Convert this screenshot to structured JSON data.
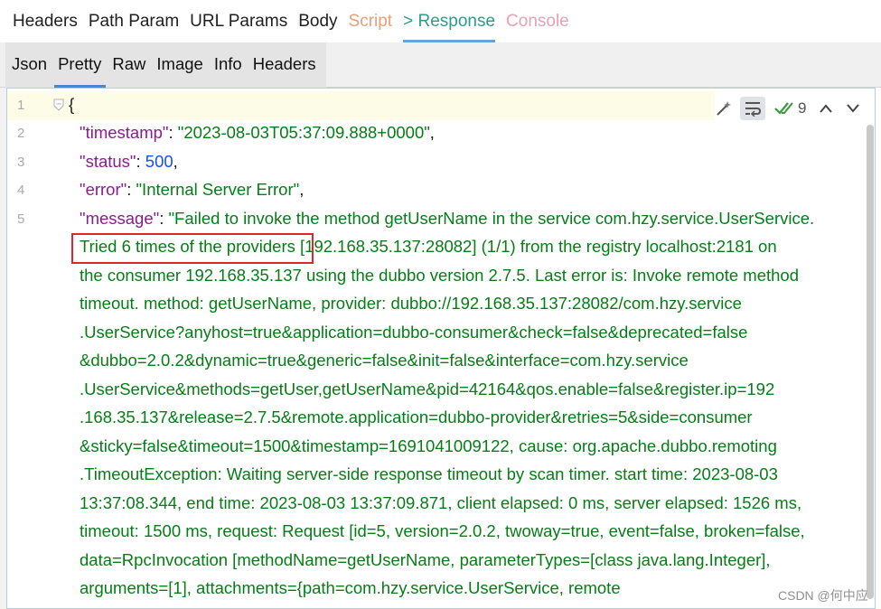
{
  "top_tabs": [
    "Headers",
    "Path Param",
    "URL Params",
    "Body",
    "Script",
    "> Response",
    "Console"
  ],
  "sub_tabs": [
    "Json",
    "Pretty",
    "Raw",
    "Image",
    "Info",
    "Headers"
  ],
  "editor": {
    "line_numbers": [
      "1",
      "2",
      "3",
      "4",
      "5"
    ],
    "line1": "{",
    "line2_key": "\"timestamp\"",
    "line2_sep": ": ",
    "line2_val": "\"2023-08-03T05:37:09.888+0000\"",
    "line2_end": ",",
    "line3_key": "\"status\"",
    "line3_sep": ": ",
    "line3_val": "500",
    "line3_end": ",",
    "line4_key": "\"error\"",
    "line4_sep": ": ",
    "line4_val": "\"Internal Server Error\"",
    "line4_end": ",",
    "line5_key": "\"message\"",
    "line5_sep": ": ",
    "message_lines": [
      "\"Failed to invoke the method getUserName in the service com.hzy.service.UserService.",
      "Tried 6 times of the providers [192.168.35.137:28082] (1/1) from the registry localhost:2181 on",
      "the consumer 192.168.35.137 using the dubbo version 2.7.5. Last error is: Invoke remote method",
      "timeout. method: getUserName, provider: dubbo://192.168.35.137:28082/com.hzy.service",
      ".UserService?anyhost=true&application=dubbo-consumer&check=false&deprecated=false",
      "&dubbo=2.0.2&dynamic=true&generic=false&init=false&interface=com.hzy.service",
      ".UserService&methods=getUser,getUserName&pid=42164&qos.enable=false&register.ip=192",
      ".168.35.137&release=2.7.5&remote.application=dubbo-provider&retries=5&side=consumer",
      "&sticky=false&timeout=1500&timestamp=1691041009122, cause: org.apache.dubbo.remoting",
      ".TimeoutException: Waiting server-side response timeout by scan timer. start time: 2023-08-03",
      "13:37:08.344, end time: 2023-08-03 13:37:09.871, client elapsed: 0 ms, server elapsed: 1526 ms,",
      "timeout: 1500 ms, request: Request [id=5, version=2.0.2, twoway=true, event=false, broken=false,",
      "data=RpcInvocation [methodName=getUserName, parameterTypes=[class java.lang.Integer],",
      "arguments=[1], attachments={path=com.hzy.service.UserService, remote"
    ],
    "toolbar": {
      "magic_icon": "magic-wand-icon",
      "wrap_icon": "soft-wrap-icon",
      "check_icon": "double-check-icon",
      "problem_count": "9"
    }
  },
  "watermark": "CSDN @何中应",
  "colors": {
    "key": "#8a1c8e",
    "string": "#067d17",
    "number": "#1750eb",
    "highlight": "#e0252b",
    "active_tab": "#2e9c8c"
  }
}
